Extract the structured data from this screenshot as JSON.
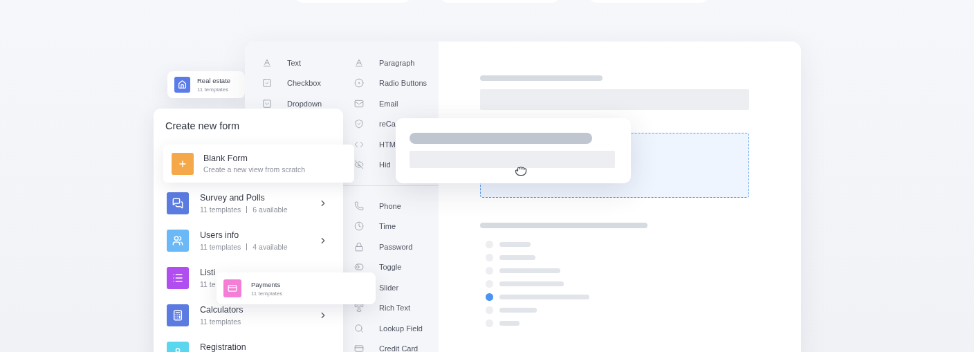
{
  "fields_panel": {
    "left_column": [
      {
        "label": "Text",
        "kind": "text"
      },
      {
        "label": "Checkbox",
        "kind": "checkbox"
      },
      {
        "label": "Dropdown",
        "kind": "dropdown"
      }
    ],
    "right_column": [
      {
        "label": "Paragraph",
        "kind": "text"
      },
      {
        "label": "Radio Buttons",
        "kind": "radio"
      },
      {
        "label": "Email",
        "kind": "email"
      },
      {
        "label": "reCa",
        "kind": "shield"
      },
      {
        "label": "HTM",
        "kind": "code"
      },
      {
        "label": "Hid",
        "kind": "hidden"
      }
    ],
    "right_column_more": [
      {
        "label": "Phone",
        "kind": "phone"
      },
      {
        "label": "Time",
        "kind": "time"
      },
      {
        "label": "Password",
        "kind": "password"
      },
      {
        "label": "Toggle",
        "kind": "toggle"
      },
      {
        "label": "Slider",
        "kind": "slider"
      },
      {
        "label": "Rich Text",
        "kind": "richtext"
      },
      {
        "label": "Lookup Field",
        "kind": "lookup"
      },
      {
        "label": "Credit Card",
        "kind": "card"
      }
    ]
  },
  "preview": {
    "options": [
      {
        "selected": false
      },
      {
        "selected": false
      },
      {
        "selected": false
      },
      {
        "selected": false
      },
      {
        "selected": true
      },
      {
        "selected": false
      },
      {
        "selected": false
      }
    ]
  },
  "real_estate_card": {
    "title": "Real estate",
    "subtitle": "11 templates",
    "color": "#5b7be8"
  },
  "create_form": {
    "title": "Create new form",
    "blank": {
      "title": "Blank Form",
      "subtitle": "Create a new view from scratch"
    },
    "categories": [
      {
        "title": "Survey and Polls",
        "templates": "11 templates",
        "available": "6 available",
        "color": "#5b7be0",
        "kind": "chat",
        "chevron": true
      },
      {
        "title": "Users info",
        "templates": "11 templates",
        "available": "4 available",
        "color": "#6bb8f7",
        "kind": "users",
        "chevron": true
      },
      {
        "title": "Listi",
        "templates": "11 te",
        "color": "#b04ef0",
        "kind": "list",
        "chevron": false
      },
      {
        "title": "Calculators",
        "templates": "11 templates",
        "color": "#5b7be0",
        "kind": "calculator",
        "chevron": true
      },
      {
        "title": "Registration",
        "color": "#5ad7ef",
        "kind": "user",
        "chevron": false
      }
    ]
  },
  "payments_card": {
    "title": "Payments",
    "subtitle": "11 templates",
    "color": "#f47ed6"
  }
}
